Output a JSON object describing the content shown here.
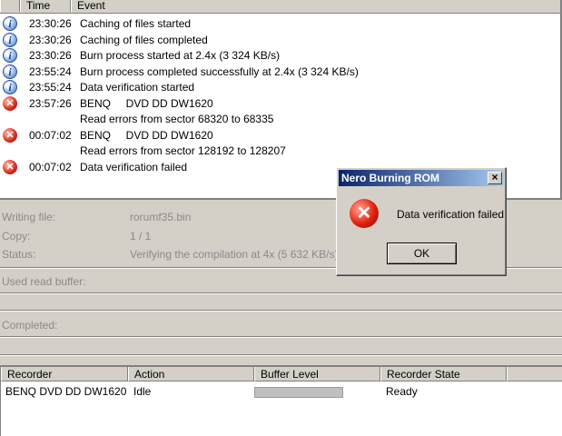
{
  "log": {
    "columns": [
      "Time",
      "Event"
    ],
    "rows": [
      {
        "icon": "info",
        "time": "23:30:26",
        "event": "Caching of files started"
      },
      {
        "icon": "info",
        "time": "23:30:26",
        "event": "Caching of files completed"
      },
      {
        "icon": "info",
        "time": "23:30:26",
        "event": "Burn process started at 2.4x (3 324 KB/s)"
      },
      {
        "icon": "info",
        "time": "23:55:24",
        "event": "Burn process completed successfully at 2.4x (3 324 KB/s)"
      },
      {
        "icon": "info",
        "time": "23:55:24",
        "event": "Data verification started"
      },
      {
        "icon": "error",
        "time": "23:57:26",
        "event": "BENQ     DVD DD DW1620"
      },
      {
        "icon": "",
        "time": "",
        "event": "Read errors from sector 68320 to 68335"
      },
      {
        "icon": "error",
        "time": "00:07:02",
        "event": "BENQ     DVD DD DW1620"
      },
      {
        "icon": "",
        "time": "",
        "event": "Read errors from sector 128192 to 128207"
      },
      {
        "icon": "error",
        "time": "00:07:02",
        "event": "Data verification failed"
      }
    ]
  },
  "progress": {
    "writing_file_label": "Writing file:",
    "writing_file_value": "rorumf35.bin",
    "copy_label": "Copy:",
    "copy_value": "1 / 1",
    "status_label": "Status:",
    "status_value": "Verifying the compilation at 4x (5 632 KB/s)",
    "used_read_buffer_label": "Used read buffer:",
    "completed_label": "Completed:"
  },
  "recorder_table": {
    "columns": [
      "Recorder",
      "Action",
      "Buffer Level",
      "Recorder State"
    ],
    "row": {
      "recorder": "BENQ DVD DD DW1620",
      "action": "Idle",
      "state": "Ready"
    }
  },
  "dialog": {
    "title": "Nero Burning ROM",
    "close_glyph": "×",
    "error_glyph": "✕",
    "message": "Data verification failed",
    "ok_label": "OK"
  },
  "icons": {
    "info": "i",
    "error": "✕"
  }
}
